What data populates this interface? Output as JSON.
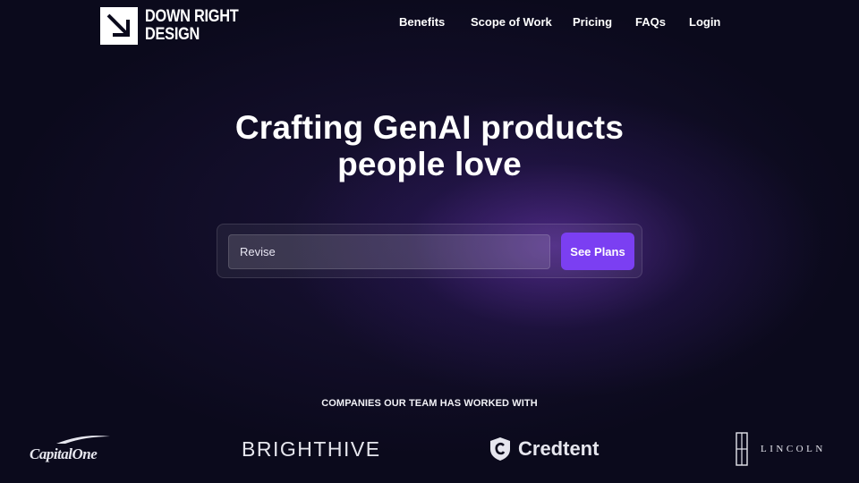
{
  "brand": {
    "line1": "DOWN RIGHT",
    "line2": "DESIGN",
    "logo_icon": "arrow-down-right-icon"
  },
  "nav": {
    "items": [
      {
        "label": "Benefits"
      },
      {
        "label": "Scope of Work"
      },
      {
        "label": "Pricing"
      },
      {
        "label": "FAQs"
      },
      {
        "label": "Login"
      }
    ]
  },
  "hero": {
    "title_line1": "Crafting GenAI products",
    "title_line2": "people love"
  },
  "form": {
    "input_value": "Revise",
    "button_label": "See Plans"
  },
  "companies": {
    "heading": "COMPANIES OUR TEAM HAS WORKED WITH",
    "logos": [
      {
        "name": "Capital One",
        "text": "CapitalOne"
      },
      {
        "name": "BrightHive",
        "text": "BRIGHTHIVE"
      },
      {
        "name": "Credtent",
        "text": "Credtent",
        "icon": "shield-c-icon"
      },
      {
        "name": "Lincoln",
        "text": "LINCOLN",
        "icon": "lincoln-star-icon"
      }
    ]
  },
  "colors": {
    "background": "#0b0a1c",
    "accent": "#7b3ff2",
    "glow": "#7a3cc8"
  }
}
